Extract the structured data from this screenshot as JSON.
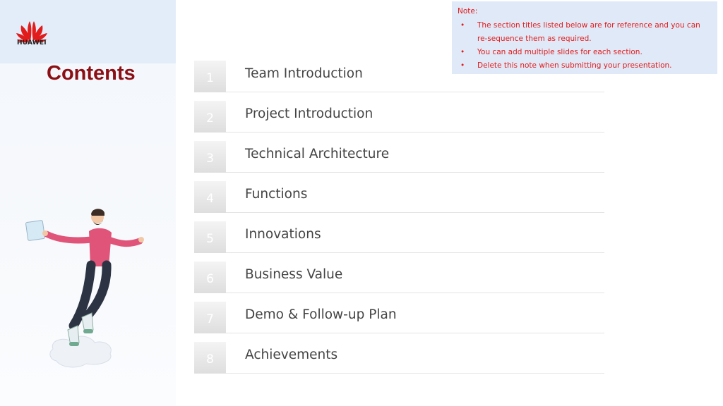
{
  "brand": {
    "name": "HUAWEI",
    "color": "#e21b1b"
  },
  "title": "Contents",
  "note": {
    "heading": "Note:",
    "items": [
      "The section titles listed below are for reference and you can re-sequence them as required.",
      "You can add multiple slides for each section.",
      "Delete this note when submitting your presentation."
    ]
  },
  "toc": [
    {
      "num": "1",
      "label": "Team Introduction"
    },
    {
      "num": "2",
      "label": "Project Introduction"
    },
    {
      "num": "3",
      "label": "Technical Architecture"
    },
    {
      "num": "4",
      "label": "Functions"
    },
    {
      "num": "5",
      "label": "Innovations"
    },
    {
      "num": "6",
      "label": "Business Value"
    },
    {
      "num": "7",
      "label": "Demo & Follow-up Plan"
    },
    {
      "num": "8",
      "label": "Achievements"
    }
  ]
}
